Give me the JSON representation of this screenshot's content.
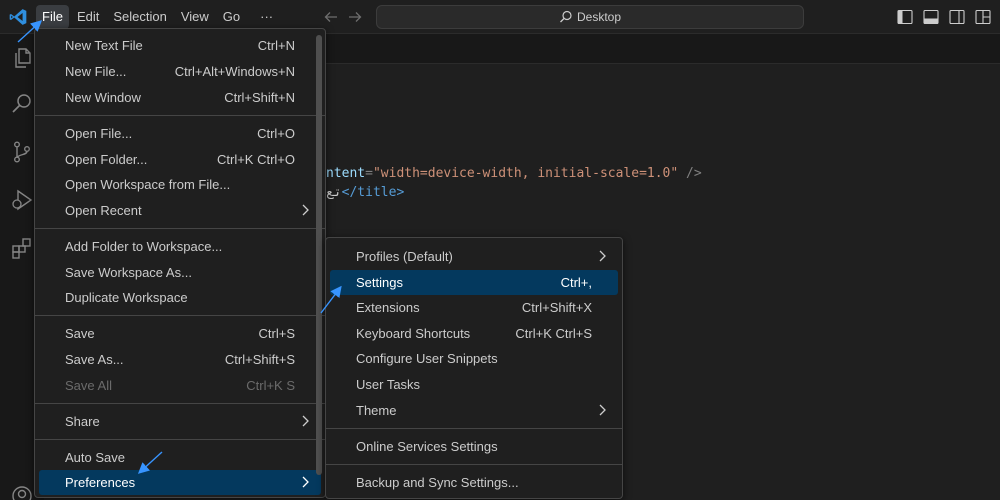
{
  "menubar": {
    "file": "File",
    "edit": "Edit",
    "selection": "Selection",
    "view": "View",
    "go": "Go",
    "more": "···"
  },
  "command_center": {
    "label": "Desktop"
  },
  "editor": {
    "line1": {
      "attr": "ntent",
      "eq": "=",
      "value": "\"width=device-width, initial-scale=1.0\"",
      "end": " />"
    },
    "line2": {
      "text": "تع",
      "close": "</title>"
    }
  },
  "file_menu": {
    "new_text_file": {
      "label": "New Text File",
      "key": "Ctrl+N"
    },
    "new_file": {
      "label": "New File...",
      "key": "Ctrl+Alt+Windows+N"
    },
    "new_window": {
      "label": "New Window",
      "key": "Ctrl+Shift+N"
    },
    "open_file": {
      "label": "Open File...",
      "key": "Ctrl+O"
    },
    "open_folder": {
      "label": "Open Folder...",
      "key": "Ctrl+K Ctrl+O"
    },
    "open_workspace": {
      "label": "Open Workspace from File..."
    },
    "open_recent": {
      "label": "Open Recent"
    },
    "add_folder": {
      "label": "Add Folder to Workspace..."
    },
    "save_workspace_as": {
      "label": "Save Workspace As..."
    },
    "duplicate_workspace": {
      "label": "Duplicate Workspace"
    },
    "save": {
      "label": "Save",
      "key": "Ctrl+S"
    },
    "save_as": {
      "label": "Save As...",
      "key": "Ctrl+Shift+S"
    },
    "save_all": {
      "label": "Save All",
      "key": "Ctrl+K S"
    },
    "share": {
      "label": "Share"
    },
    "auto_save": {
      "label": "Auto Save"
    },
    "preferences": {
      "label": "Preferences"
    }
  },
  "pref_menu": {
    "profiles": {
      "label": "Profiles (Default)"
    },
    "settings": {
      "label": "Settings",
      "key": "Ctrl+,"
    },
    "extensions": {
      "label": "Extensions",
      "key": "Ctrl+Shift+X"
    },
    "keyboard_shortcuts": {
      "label": "Keyboard Shortcuts",
      "key": "Ctrl+K Ctrl+S"
    },
    "user_snippets": {
      "label": "Configure User Snippets"
    },
    "user_tasks": {
      "label": "User Tasks"
    },
    "theme": {
      "label": "Theme"
    },
    "online_services": {
      "label": "Online Services Settings"
    },
    "backup_sync": {
      "label": "Backup and Sync Settings..."
    }
  },
  "colors": {
    "accent": "#0078d4",
    "selection": "#04395e",
    "annotation_arrow": "#3794ff"
  },
  "icons": {
    "app": "vscode-logo-icon",
    "explorer": "files-icon",
    "search": "search-icon",
    "scm": "source-control-icon",
    "debug": "run-debug-icon",
    "extensions": "extensions-icon",
    "accounts": "account-icon",
    "submenu": "chevron-right-icon"
  }
}
